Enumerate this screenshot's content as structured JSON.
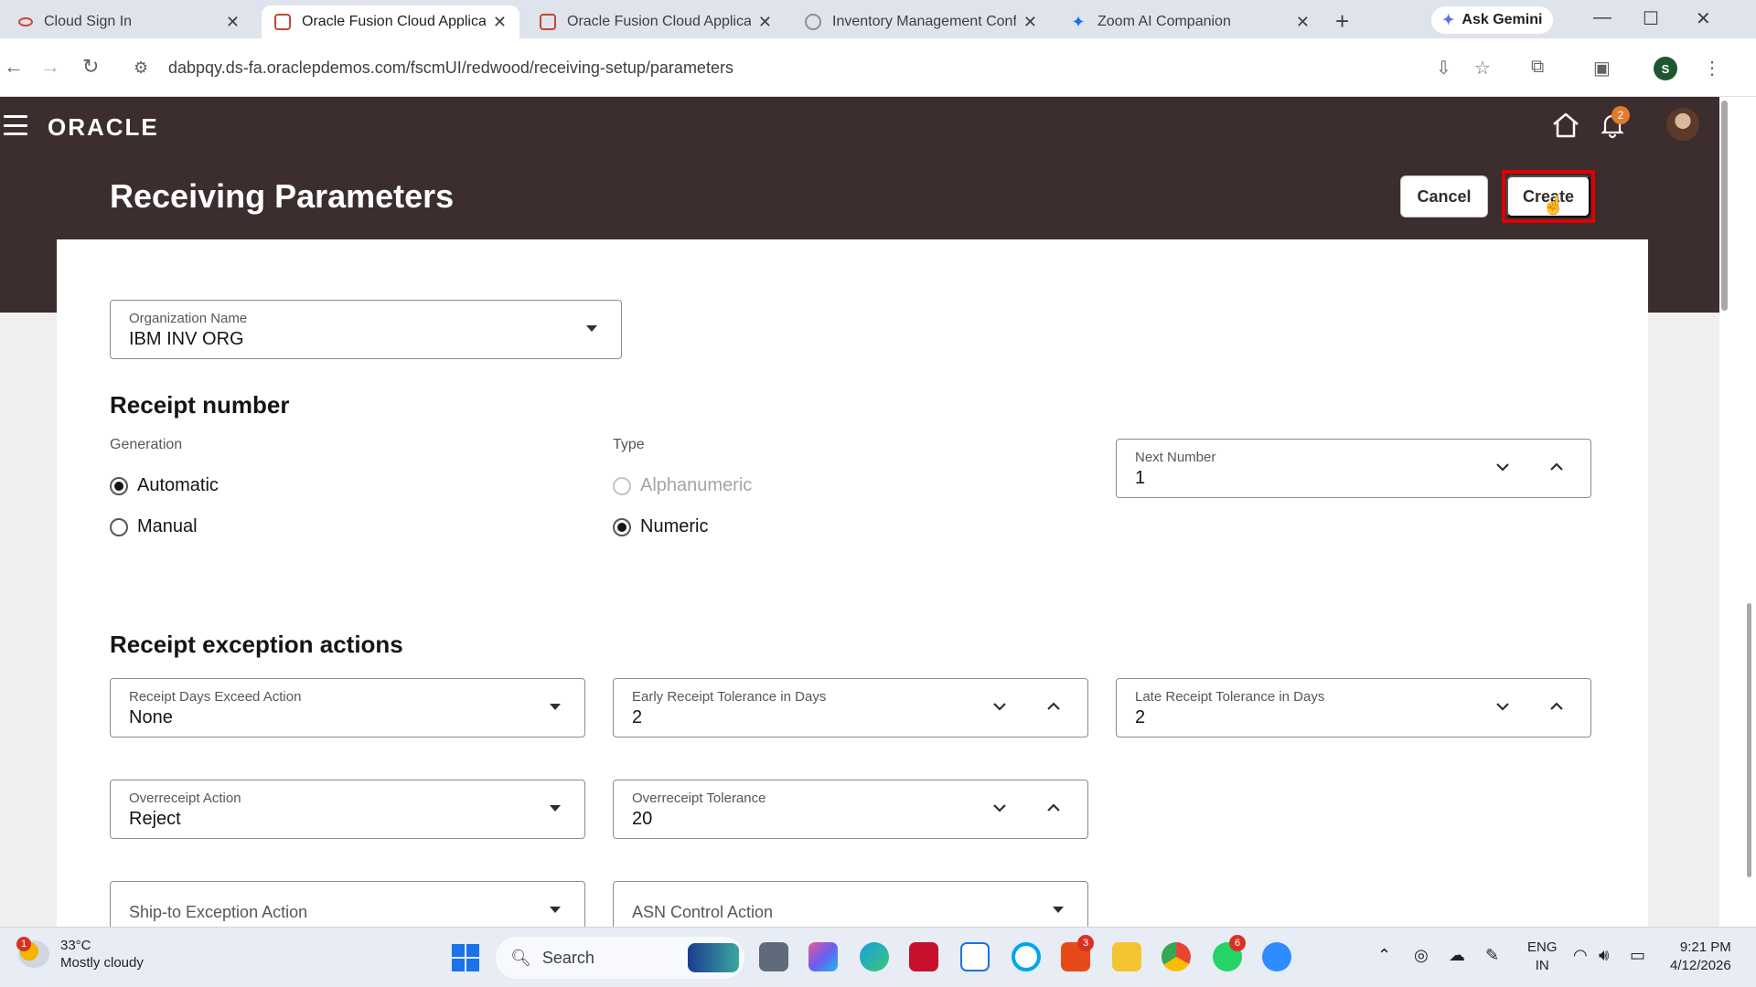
{
  "browser": {
    "tabs": [
      {
        "title": "Cloud Sign In",
        "icon": "oracle-cloud-icon",
        "active": false
      },
      {
        "title": "Oracle Fusion Cloud Applicati",
        "icon": "oracle-icon",
        "active": true
      },
      {
        "title": "Oracle Fusion Cloud Applicati",
        "icon": "oracle-icon",
        "active": false
      },
      {
        "title": "Inventory Management Config",
        "icon": "globe-icon",
        "active": false
      },
      {
        "title": "Zoom AI Companion",
        "icon": "sparkle-icon",
        "active": false
      }
    ],
    "ask_gemini": "Ask Gemini",
    "url": "dabpqy.ds-fa.oraclepdemos.com/fscmUI/redwood/receiving-setup/parameters",
    "profile_initial": "S"
  },
  "app": {
    "logo": "ORACLE",
    "notification_count": "2",
    "page_title": "Receiving Parameters",
    "cancel_label": "Cancel",
    "create_label": "Create",
    "organization": {
      "label": "Organization Name",
      "value": "IBM INV ORG"
    },
    "receipt_number": {
      "heading": "Receipt number",
      "generation_label": "Generation",
      "generation_options": [
        "Automatic",
        "Manual"
      ],
      "generation_selected": "Automatic",
      "type_label": "Type",
      "type_options": [
        "Alphanumeric",
        "Numeric"
      ],
      "type_selected": "Numeric",
      "next_number": {
        "label": "Next Number",
        "value": "1"
      }
    },
    "exceptions": {
      "heading": "Receipt exception actions",
      "receipt_days_exceed_action": {
        "label": "Receipt Days Exceed Action",
        "value": "None"
      },
      "early_receipt_tolerance": {
        "label": "Early Receipt Tolerance in Days",
        "value": "2"
      },
      "late_receipt_tolerance": {
        "label": "Late Receipt Tolerance in Days",
        "value": "2"
      },
      "overreceipt_action": {
        "label": "Overreceipt Action",
        "value": "Reject"
      },
      "overreceipt_tolerance": {
        "label": "Overreceipt Tolerance",
        "value": "20"
      },
      "ship_to_exception_action": {
        "label": "Ship-to Exception Action"
      },
      "asn_control_action": {
        "label": "ASN Control Action"
      }
    }
  },
  "taskbar": {
    "weather_temp": "33°C",
    "weather_desc": "Mostly cloudy",
    "weather_badge": "1",
    "search_placeholder": "Search",
    "office_badge": "3",
    "whatsapp_badge": "6",
    "lang_top": "ENG",
    "lang_bottom": "IN",
    "time": "9:21 PM",
    "date": "4/12/2026"
  }
}
